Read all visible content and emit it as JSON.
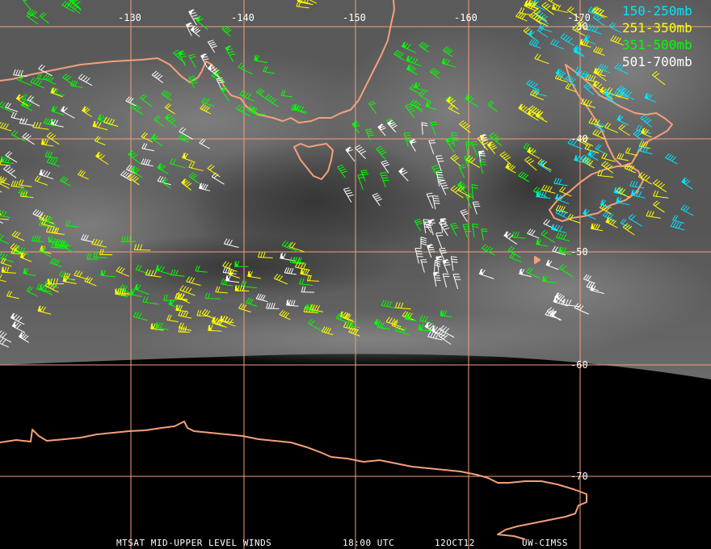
{
  "title": "MTSAT MID-UPPER LEVEL WINDS",
  "footer": {
    "product": "MTSAT MID-UPPER LEVEL WINDS",
    "time": "18:00 UTC",
    "date": "12OCT12",
    "source": "UW-CIMSS"
  },
  "longitude_labels": [
    "-130",
    "-140",
    "-150",
    "-160",
    "-170"
  ],
  "latitude_labels": [
    "-30",
    "-40",
    "-50",
    "-60",
    "-70"
  ],
  "legend": [
    {
      "label": "150-250mb",
      "color": "#00e5ff"
    },
    {
      "label": "251-350mb",
      "color": "#ffff00"
    },
    {
      "label": "351-500mb",
      "color": "#00ff00"
    },
    {
      "label": "501-700mb",
      "color": "#ffffff"
    }
  ],
  "colors": {
    "grid": "#f4a07a",
    "coast": "#f4a07a",
    "space": "#000000"
  }
}
